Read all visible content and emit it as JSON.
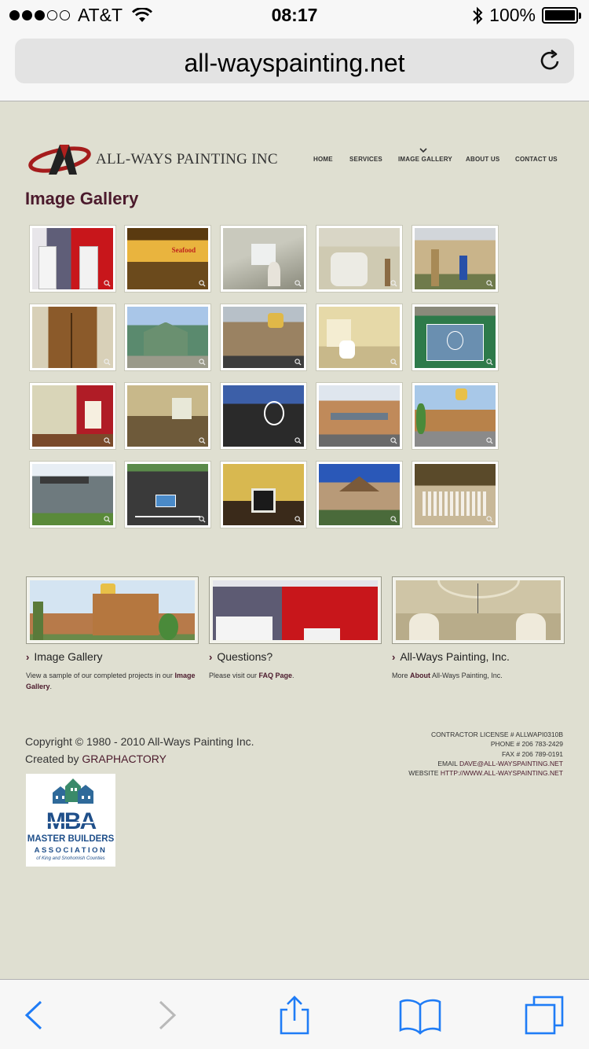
{
  "status_bar": {
    "carrier": "AT&T",
    "time": "08:17",
    "battery": "100%"
  },
  "browser": {
    "url": "all-wayspainting.net"
  },
  "site": {
    "logo_text": "ALL-WAYS PAINTING INC",
    "nav": [
      "HOME",
      "SERVICES",
      "IMAGE GALLERY",
      "ABOUT US",
      "CONTACT US"
    ],
    "page_title": "Image Gallery",
    "gallery_count": 20
  },
  "features": [
    {
      "title": "Image Gallery",
      "desc_prefix": "View a sample of our completed projects in our ",
      "desc_link": "Image Gallery",
      "desc_suffix": "."
    },
    {
      "title": "Questions?",
      "desc_prefix": "Please visit our ",
      "desc_link": "FAQ Page",
      "desc_suffix": "."
    },
    {
      "title": "All-Ways Painting, Inc.",
      "desc_prefix": "More ",
      "desc_link": "About",
      "desc_suffix": " All-Ways Painting, Inc."
    }
  ],
  "footer": {
    "copyright": "Copyright © 1980 - 2010 All-Ways Painting Inc.",
    "created_by_label": "Created by ",
    "created_by_link": "GRAPHACTORY",
    "license": "CONTRACTOR LICENSE # ALLWAPI0310B",
    "phone": "PHONE # 206 783-2429",
    "fax": "FAX # 206 789-0191",
    "email_label": "EMAIL ",
    "email": "DAVE@ALL-WAYSPAINTING.NET",
    "website_label": "WEBSITE ",
    "website": "HTTP://WWW.ALL-WAYSPAINTING.NET",
    "badge_line1": "MASTER BUILDERS",
    "badge_line2": "ASSOCIATION",
    "badge_line3": "of King and Snohomish Counties"
  },
  "colors": {
    "page_bg": "#dfdfd1",
    "accent": "#4b1a2c",
    "ios_blue": "#1f7cf6"
  }
}
